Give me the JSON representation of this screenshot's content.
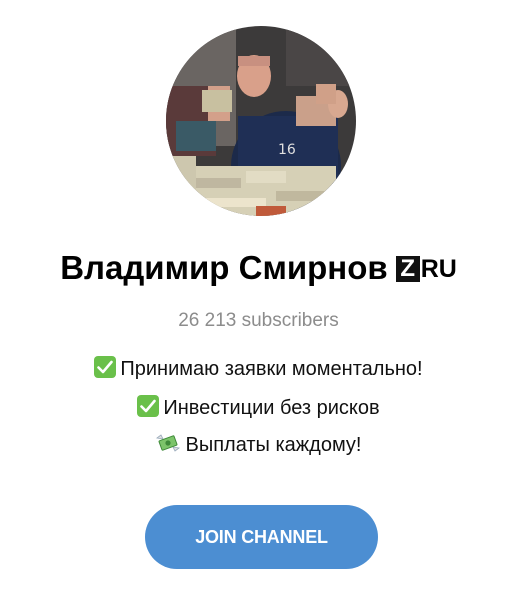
{
  "channel": {
    "name": "Владимир Смирнов",
    "badge_letter": "Z",
    "badge_suffix": "RU",
    "subscribers": "26 213 subscribers"
  },
  "description": {
    "line1": "Принимаю заявки моментально!",
    "line2": "Инвестиции без рисков",
    "line3": "Выплаты каждому!",
    "line1_icon": "check-mark-button-icon",
    "line2_icon": "check-mark-button-icon",
    "line3_icon": "money-with-wings-icon"
  },
  "actions": {
    "join_label": "JOIN CHANNEL"
  },
  "colors": {
    "button": "#4c8ed2",
    "subscribers_text": "#8c8c8c",
    "check_green": "#6ac04a"
  }
}
